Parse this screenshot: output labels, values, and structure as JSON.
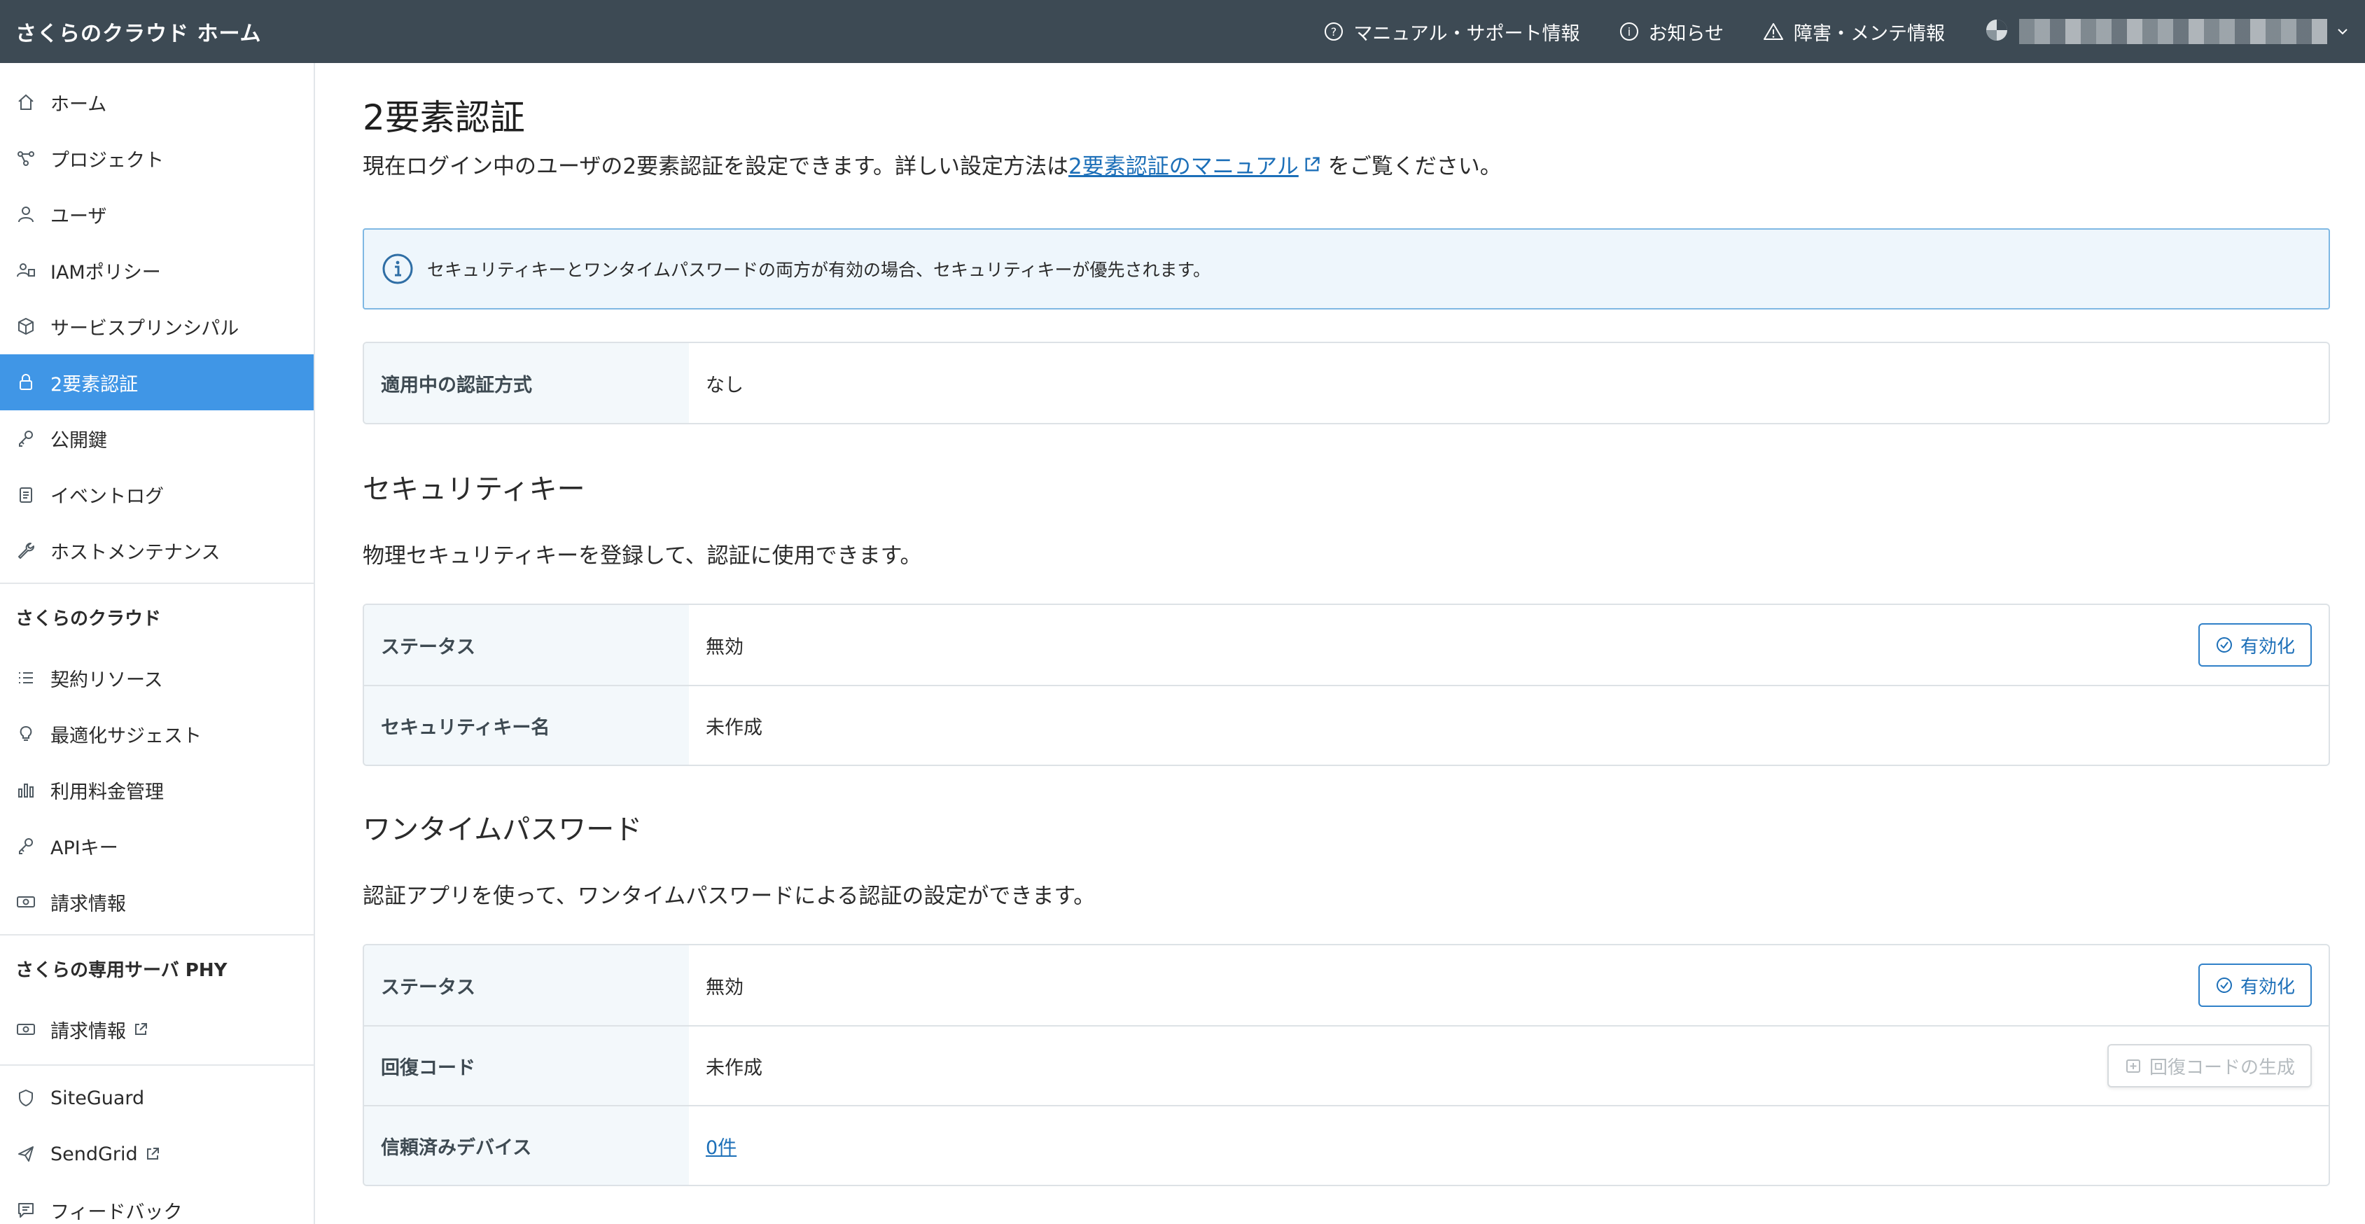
{
  "header": {
    "brand": "さくらのクラウド ホーム",
    "links": [
      {
        "icon": "help-circle-icon",
        "label": "マニュアル・サポート情報"
      },
      {
        "icon": "info-circle-icon",
        "label": "お知らせ"
      },
      {
        "icon": "warning-triangle-icon",
        "label": "障害・メンテ情報"
      }
    ]
  },
  "sidebar": {
    "items": [
      {
        "icon": "home-icon",
        "label": "ホーム"
      },
      {
        "icon": "project-icon",
        "label": "プロジェクト"
      },
      {
        "icon": "user-icon",
        "label": "ユーザ"
      },
      {
        "icon": "iam-policy-icon",
        "label": "IAMポリシー"
      },
      {
        "icon": "cube-icon",
        "label": "サービスプリンシパル"
      },
      {
        "icon": "lock-icon",
        "label": "2要素認証",
        "active": true
      },
      {
        "icon": "key-icon",
        "label": "公開鍵"
      },
      {
        "icon": "clipboard-icon",
        "label": "イベントログ"
      },
      {
        "icon": "wrench-icon",
        "label": "ホストメンテナンス"
      }
    ],
    "section_cloud": "さくらのクラウド",
    "cloud_items": [
      {
        "icon": "list-icon",
        "label": "契約リソース"
      },
      {
        "icon": "lightbulb-icon",
        "label": "最適化サジェスト"
      },
      {
        "icon": "bar-chart-icon",
        "label": "利用料金管理"
      },
      {
        "icon": "key-icon",
        "label": "APIキー"
      },
      {
        "icon": "money-icon",
        "label": "請求情報"
      }
    ],
    "section_phy": "さくらの専用サーバ PHY",
    "phy_items": [
      {
        "icon": "money-icon",
        "label": "請求情報"
      }
    ],
    "other_items": [
      {
        "icon": "shield-icon",
        "label": "SiteGuard"
      },
      {
        "icon": "send-icon",
        "label": "SendGrid"
      },
      {
        "icon": "feedback-icon",
        "label": "フィードバック"
      }
    ]
  },
  "main": {
    "title": "2要素認証",
    "lead_prefix": "現在ログイン中のユーザの2要素認証を設定できます。詳しい設定方法は",
    "lead_link": "2要素認証のマニュアル",
    "lead_suffix": "をご覧ください。",
    "info": "セキュリティキーとワンタイムパスワードの両方が有効の場合、セキュリティキーが優先されます。",
    "current_method_label": "適用中の認証方式",
    "current_method_value": "なし",
    "security_key": {
      "title": "セキュリティキー",
      "desc": "物理セキュリティキーを登録して、認証に使用できます。",
      "status_label": "ステータス",
      "status_value": "無効",
      "enable_button": "有効化",
      "name_label": "セキュリティキー名",
      "name_value": "未作成"
    },
    "otp": {
      "title": "ワンタイムパスワード",
      "desc": "認証アプリを使って、ワンタイムパスワードによる認証の設定ができます。",
      "status_label": "ステータス",
      "status_value": "無効",
      "enable_button": "有効化",
      "recovery_label": "回復コード",
      "recovery_value": "未作成",
      "recovery_button": "回復コードの生成",
      "devices_label": "信頼済みデバイス",
      "devices_value": "0件"
    }
  }
}
